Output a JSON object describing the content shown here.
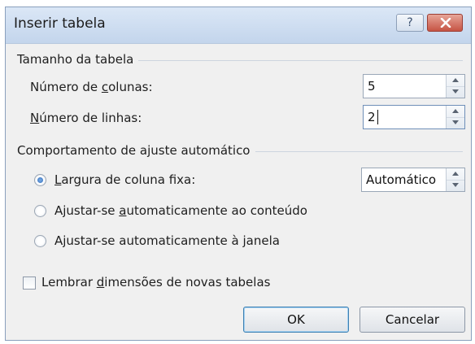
{
  "window": {
    "title": "Inserir tabela"
  },
  "titlebar": {
    "help_label": "?"
  },
  "table_size": {
    "group_label": "Tamanho da tabela",
    "columns": {
      "label_pre": "Número de ",
      "label_ul": "c",
      "label_post": "olunas:",
      "value": "5"
    },
    "rows": {
      "label_pre": "",
      "label_ul": "N",
      "label_post": "úmero de linhas:",
      "value": "2"
    }
  },
  "autofit": {
    "group_label": "Comportamento de ajuste automático",
    "options": [
      {
        "pre": "",
        "ul": "L",
        "post": "argura de coluna fixa:",
        "checked": true
      },
      {
        "pre": "Ajustar-se ",
        "ul": "a",
        "post": "utomaticamente ao conteúdo",
        "checked": false
      },
      {
        "pre": "Ajustar-se automaticamente à ",
        "ul": "j",
        "post": "anela",
        "checked": false
      }
    ],
    "fixed_width_value": "Automático"
  },
  "remember": {
    "pre": "Lembrar ",
    "ul": "d",
    "post": "imensões de novas tabelas",
    "checked": false
  },
  "buttons": {
    "ok": "OK",
    "cancel": "Cancelar"
  }
}
